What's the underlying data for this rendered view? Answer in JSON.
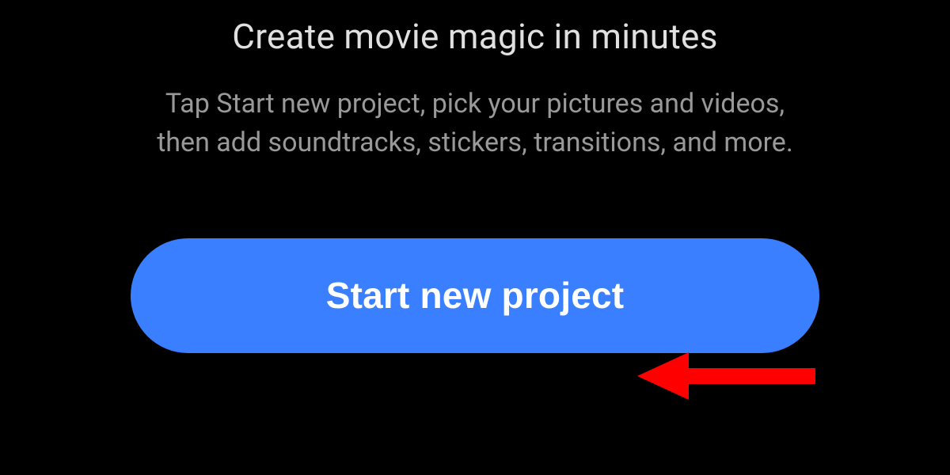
{
  "onboarding": {
    "heading": "Create movie magic in minutes",
    "subtext": "Tap Start new project, pick your pictures and videos, then add soundtracks, stickers, transitions, and more.",
    "cta_label": "Start new project"
  },
  "colors": {
    "background": "#000000",
    "heading_text": "#e0e0e0",
    "subtext_text": "#999999",
    "button_bg": "#3a7fff",
    "button_text": "#ffffff",
    "annotation": "#ff0000"
  }
}
